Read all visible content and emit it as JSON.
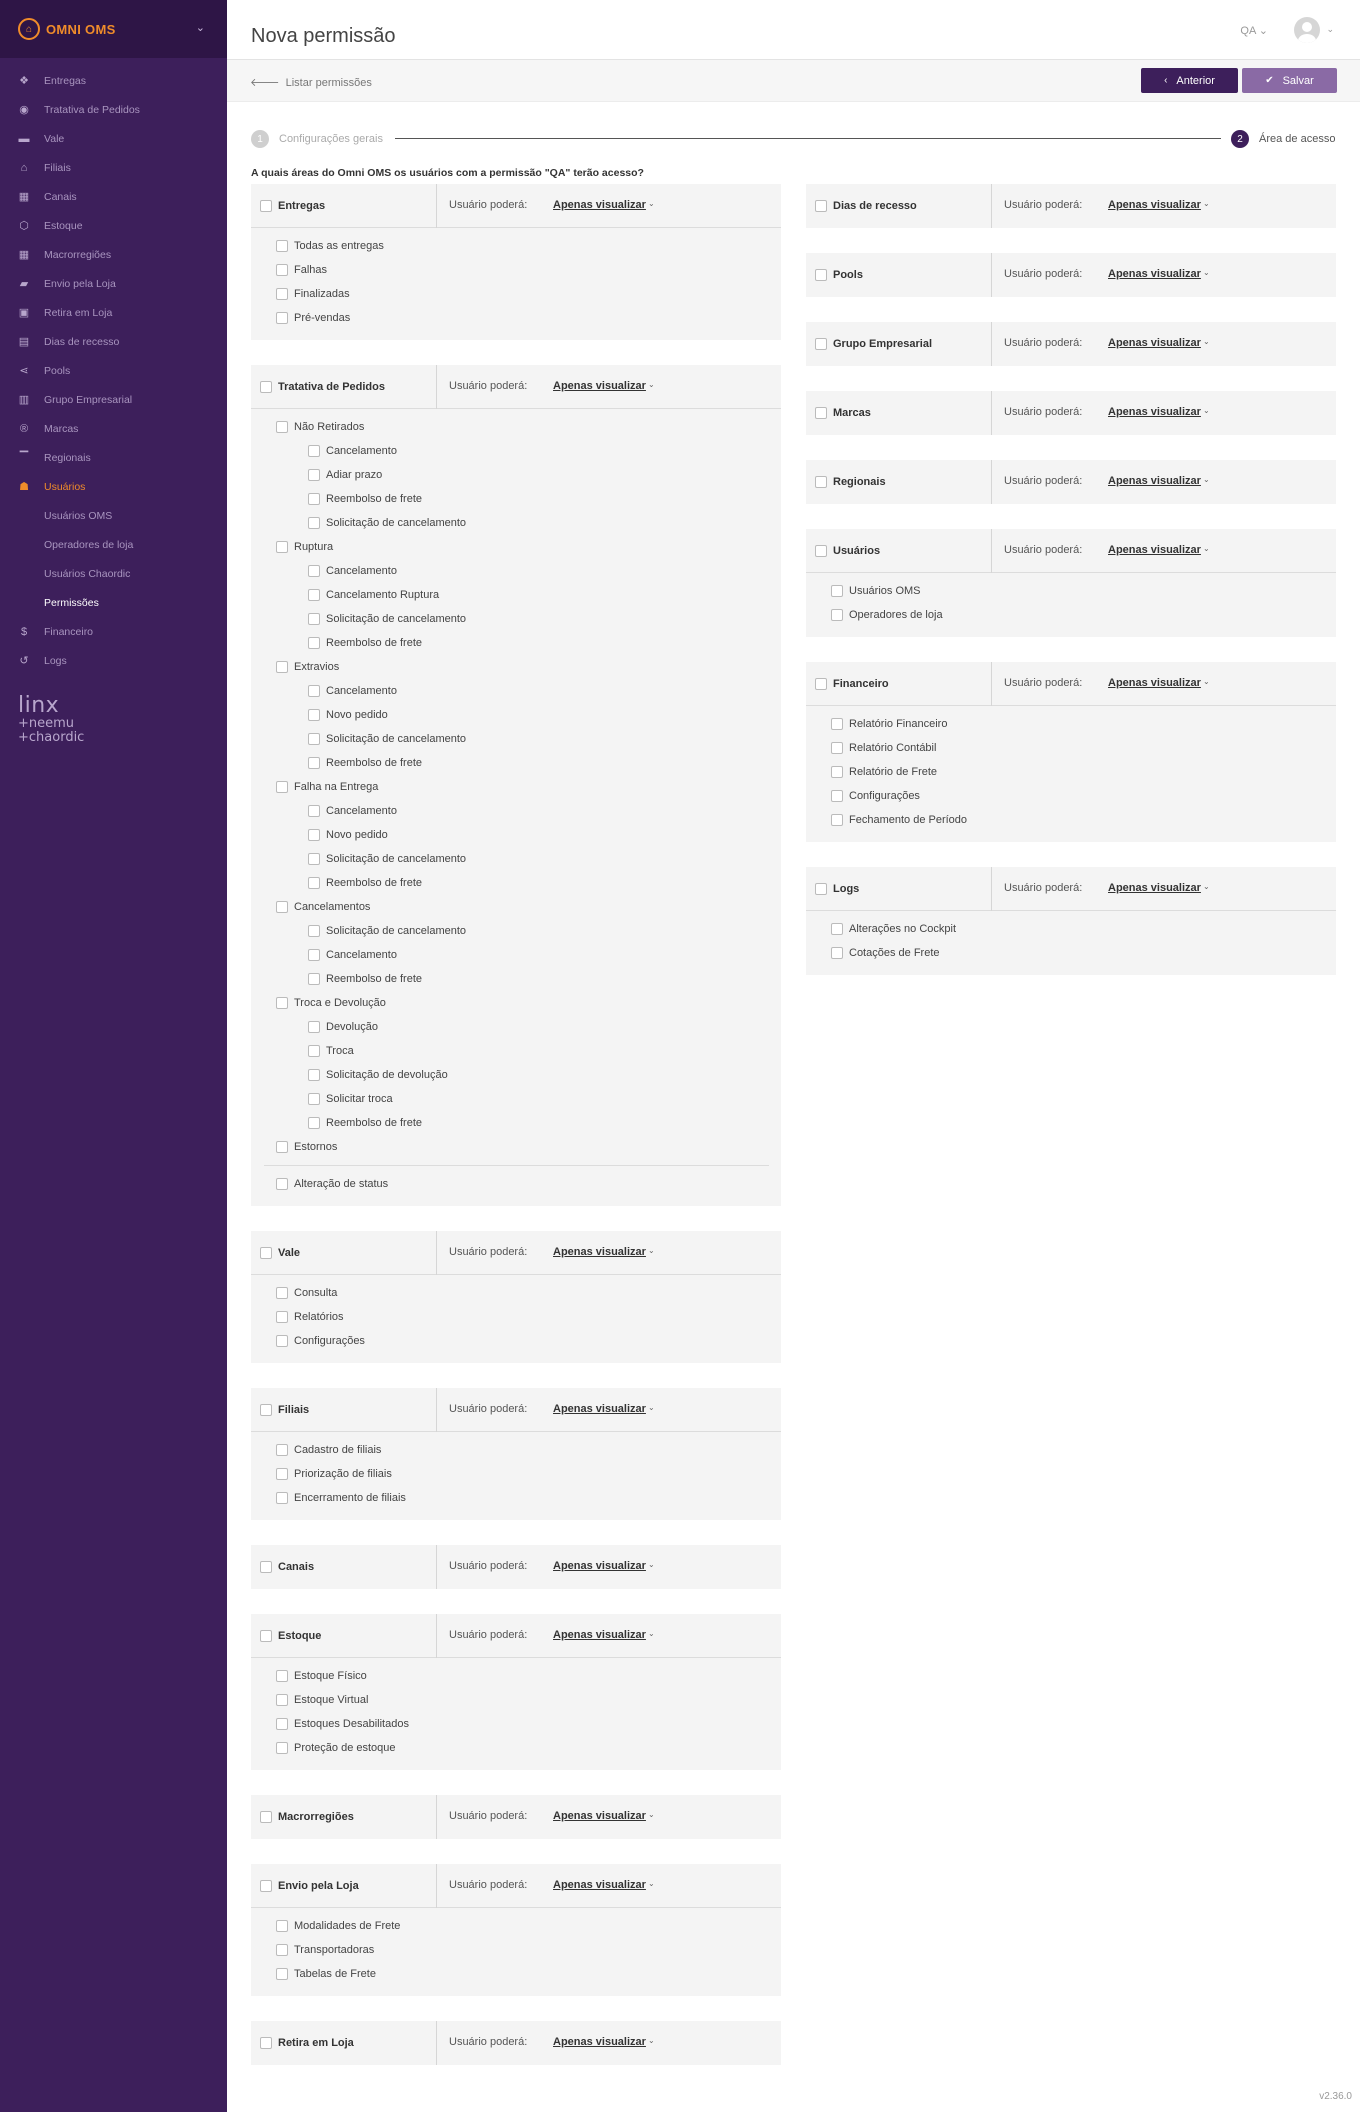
{
  "brand": {
    "name": "OMNI OMS"
  },
  "sidebar": {
    "items": [
      {
        "label": "Entregas",
        "icon": "dropbox-icon"
      },
      {
        "label": "Tratativa de Pedidos",
        "icon": "user-circle-icon"
      },
      {
        "label": "Vale",
        "icon": "card-icon"
      },
      {
        "label": "Filiais",
        "icon": "home-icon"
      },
      {
        "label": "Canais",
        "icon": "map-icon"
      },
      {
        "label": "Estoque",
        "icon": "cubes-icon"
      },
      {
        "label": "Macrorregiões",
        "icon": "map-icon"
      },
      {
        "label": "Envio pela Loja",
        "icon": "truck-icon"
      },
      {
        "label": "Retira em Loja",
        "icon": "briefcase-icon"
      },
      {
        "label": "Dias de recesso",
        "icon": "calendar-icon"
      },
      {
        "label": "Pools",
        "icon": "share-icon"
      },
      {
        "label": "Grupo Empresarial",
        "icon": "building-icon"
      },
      {
        "label": "Marcas",
        "icon": "registered-icon"
      },
      {
        "label": "Regionais",
        "icon": "institution-icon"
      },
      {
        "label": "Usuários",
        "icon": "users-icon"
      }
    ],
    "subitems": [
      {
        "label": "Usuários OMS"
      },
      {
        "label": "Operadores de loja"
      },
      {
        "label": "Usuários Chaordic"
      },
      {
        "label": "Permissões"
      }
    ],
    "bottom_items": [
      {
        "label": "Financeiro",
        "icon": "dollar-icon"
      },
      {
        "label": "Logs",
        "icon": "history-icon"
      }
    ],
    "partner_logo": {
      "line1": "linx",
      "line2": "+neemu",
      "line3": "+chaordic"
    }
  },
  "header": {
    "title": "Nova permissão",
    "user": "QA"
  },
  "toolbar": {
    "back_label": "Listar permissões",
    "prev_label": "Anterior",
    "save_label": "Salvar"
  },
  "steps": [
    {
      "number": "1",
      "label": "Configurações gerais"
    },
    {
      "number": "2",
      "label": "Área de acesso"
    }
  ],
  "question": "A quais áreas do Omni OMS os usuários com a permissão \"QA\" terão acesso?",
  "perm_label": "Usuário poderá:",
  "perm_value": "Apenas visualizar",
  "left_cards": [
    {
      "name": "Entregas",
      "items": [
        {
          "label": "Todas as entregas"
        },
        {
          "label": "Falhas"
        },
        {
          "label": "Finalizadas"
        },
        {
          "label": "Pré-vendas"
        }
      ]
    },
    {
      "name": "Tratativa de Pedidos",
      "groups": [
        {
          "label": "Não Retirados",
          "children": [
            "Cancelamento",
            "Adiar prazo",
            "Reembolso de frete",
            "Solicitação de cancelamento"
          ]
        },
        {
          "label": "Ruptura",
          "children": [
            "Cancelamento",
            "Cancelamento Ruptura",
            "Solicitação de cancelamento",
            "Reembolso de frete"
          ]
        },
        {
          "label": "Extravios",
          "children": [
            "Cancelamento",
            "Novo pedido",
            "Solicitação de cancelamento",
            "Reembolso de frete"
          ]
        },
        {
          "label": "Falha na Entrega",
          "children": [
            "Cancelamento",
            "Novo pedido",
            "Solicitação de cancelamento",
            "Reembolso de frete"
          ]
        },
        {
          "label": "Cancelamentos",
          "children": [
            "Solicitação de cancelamento",
            "Cancelamento",
            "Reembolso de frete"
          ]
        },
        {
          "label": "Troca e Devolução",
          "children": [
            "Devolução",
            "Troca",
            "Solicitação de devolução",
            "Solicitar troca",
            "Reembolso de frete"
          ]
        },
        {
          "label": "Estornos",
          "children": []
        }
      ],
      "extra": "Alteração de status"
    },
    {
      "name": "Vale",
      "items": [
        {
          "label": "Consulta"
        },
        {
          "label": "Relatórios"
        },
        {
          "label": "Configurações"
        }
      ]
    },
    {
      "name": "Filiais",
      "items": [
        {
          "label": "Cadastro de filiais"
        },
        {
          "label": "Priorização de filiais"
        },
        {
          "label": "Encerramento de filiais"
        }
      ]
    },
    {
      "name": "Canais",
      "items": []
    },
    {
      "name": "Estoque",
      "items": [
        {
          "label": "Estoque Físico"
        },
        {
          "label": "Estoque Virtual"
        },
        {
          "label": "Estoques Desabilitados"
        },
        {
          "label": "Proteção de estoque"
        }
      ]
    },
    {
      "name": "Macrorregiões",
      "items": []
    },
    {
      "name": "Envio pela Loja",
      "items": [
        {
          "label": "Modalidades de Frete"
        },
        {
          "label": "Transportadoras"
        },
        {
          "label": "Tabelas de Frete"
        }
      ]
    },
    {
      "name": "Retira em Loja",
      "items": []
    }
  ],
  "right_cards": [
    {
      "name": "Dias de recesso",
      "items": []
    },
    {
      "name": "Pools",
      "items": []
    },
    {
      "name": "Grupo Empresarial",
      "items": []
    },
    {
      "name": "Marcas",
      "items": []
    },
    {
      "name": "Regionais",
      "items": []
    },
    {
      "name": "Usuários",
      "items": [
        {
          "label": "Usuários OMS"
        },
        {
          "label": "Operadores de loja"
        }
      ]
    },
    {
      "name": "Financeiro",
      "items": [
        {
          "label": "Relatório Financeiro"
        },
        {
          "label": "Relatório Contábil"
        },
        {
          "label": "Relatório de Frete"
        },
        {
          "label": "Configurações"
        },
        {
          "label": "Fechamento de Período"
        }
      ]
    },
    {
      "name": "Logs",
      "items": [
        {
          "label": "Alterações no Cockpit"
        },
        {
          "label": "Cotações de Frete"
        }
      ]
    }
  ],
  "version": "v2.36.0"
}
